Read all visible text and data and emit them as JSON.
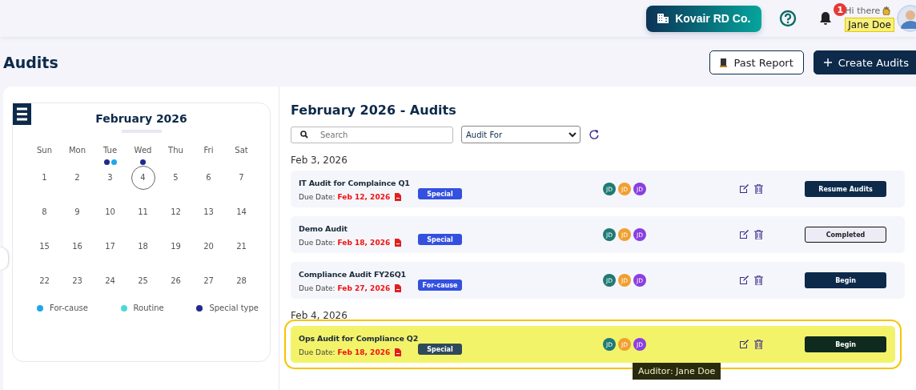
{
  "header": {
    "company": "Kovair RD Co.",
    "notifications": "1",
    "greeting": "Hi there",
    "user": "Jane Doe"
  },
  "page": {
    "title": "Audits",
    "buttons": [
      {
        "label": "Past Report",
        "kind": "outline"
      },
      {
        "label": "Create Audits",
        "kind": "primary"
      }
    ]
  },
  "calendar": {
    "month": "February 2026",
    "weekdays": [
      "Sun",
      "Mon",
      "Tue",
      "Wed",
      "Thu",
      "Fri",
      "Sat"
    ],
    "days": [
      {
        "day": "1",
        "selected": false
      },
      {
        "day": "2",
        "selected": false
      },
      {
        "day": "3",
        "selected": false,
        "dots": [
          {
            "color": "#1f2a8c"
          },
          {
            "color": "#1ea7ea"
          }
        ]
      },
      {
        "day": "4",
        "selected": true,
        "dots": [
          {
            "color": "#1f2a8c"
          }
        ]
      },
      {
        "day": "5",
        "selected": false
      },
      {
        "day": "6",
        "selected": false
      },
      {
        "day": "7",
        "selected": false
      },
      {
        "day": "8",
        "selected": false
      },
      {
        "day": "9",
        "selected": false
      },
      {
        "day": "10",
        "selected": false
      },
      {
        "day": "11",
        "selected": false
      },
      {
        "day": "12",
        "selected": false
      },
      {
        "day": "13",
        "selected": false
      },
      {
        "day": "14",
        "selected": false
      },
      {
        "day": "15",
        "selected": false
      },
      {
        "day": "16",
        "selected": false
      },
      {
        "day": "17",
        "selected": false
      },
      {
        "day": "18",
        "selected": false
      },
      {
        "day": "19",
        "selected": false
      },
      {
        "day": "20",
        "selected": false
      },
      {
        "day": "21",
        "selected": false
      },
      {
        "day": "22",
        "selected": false
      },
      {
        "day": "23",
        "selected": false
      },
      {
        "day": "24",
        "selected": false
      },
      {
        "day": "25",
        "selected": false
      },
      {
        "day": "26",
        "selected": false
      },
      {
        "day": "27",
        "selected": false
      },
      {
        "day": "28",
        "selected": false
      }
    ],
    "legend": [
      {
        "label": "For-cause",
        "color": "#1ea7ea"
      },
      {
        "label": "Routine",
        "color": "#4fd8dc"
      },
      {
        "label": "Special type",
        "color": "#1f2a8c"
      }
    ]
  },
  "audits": {
    "title": "February 2026 - Audits",
    "search": {
      "placeholder": "Search"
    },
    "filter": {
      "value": "Audit For"
    },
    "groups": [
      {
        "date": "Feb 3, 2026",
        "items": [
          {
            "title": "IT Audit for Complaince Q1",
            "due_label": "Due Date:",
            "due": "Feb 12, 2026",
            "badge": "Special",
            "highlighted": false,
            "auditors": [
              {
                "initials": "JD",
                "color": "#1f7a74"
              },
              {
                "initials": "JD",
                "color": "#f0a030"
              },
              {
                "initials": "JD",
                "color": "#8a3fe0"
              }
            ],
            "action": {
              "label": "Resume Audits",
              "kind": "primary"
            }
          },
          {
            "title": "Demo Audit",
            "due_label": "Due Date:",
            "due": "Feb 18, 2026",
            "badge": "Special",
            "highlighted": false,
            "auditors": [
              {
                "initials": "JD",
                "color": "#1f7a74"
              },
              {
                "initials": "JD",
                "color": "#f0a030"
              },
              {
                "initials": "JD",
                "color": "#8a3fe0"
              }
            ],
            "action": {
              "label": "Completed",
              "kind": "outline"
            }
          },
          {
            "title": "Compliance Audit FY26Q1",
            "due_label": "Due Date:",
            "due": "Feb 27, 2026",
            "badge": "For-cause",
            "highlighted": false,
            "auditors": [
              {
                "initials": "JD",
                "color": "#1f7a74"
              },
              {
                "initials": "JD",
                "color": "#f0a030"
              },
              {
                "initials": "JD",
                "color": "#8a3fe0"
              }
            ],
            "action": {
              "label": "Begin",
              "kind": "primary"
            }
          }
        ]
      },
      {
        "date": "Feb 4, 2026",
        "items": [
          {
            "title": "Ops Audit for Compliance Q2",
            "due_label": "Due Date:",
            "due": "Feb 18, 2026",
            "badge": "Special",
            "highlighted": true,
            "auditors": [
              {
                "initials": "JD",
                "color": "#1f7a74"
              },
              {
                "initials": "JD",
                "color": "#f0a030"
              },
              {
                "initials": "JD",
                "color": "#8a3fe0"
              }
            ],
            "action": {
              "label": "Begin",
              "kind": "primary"
            },
            "tooltip": "Auditor: Jane Doe"
          }
        ]
      }
    ]
  }
}
